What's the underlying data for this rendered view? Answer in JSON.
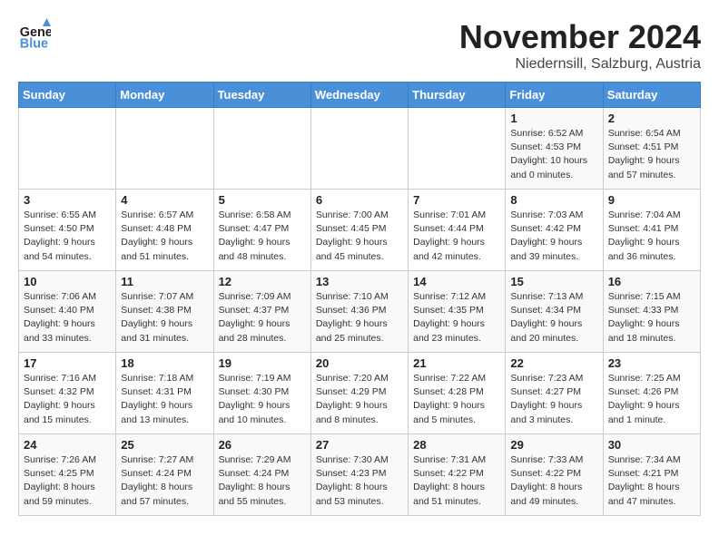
{
  "logo": {
    "line1": "General",
    "line2": "Blue"
  },
  "title": "November 2024",
  "subtitle": "Niedernsill, Salzburg, Austria",
  "header": {
    "days": [
      "Sunday",
      "Monday",
      "Tuesday",
      "Wednesday",
      "Thursday",
      "Friday",
      "Saturday"
    ]
  },
  "weeks": [
    {
      "cells": [
        {
          "day": "",
          "info": ""
        },
        {
          "day": "",
          "info": ""
        },
        {
          "day": "",
          "info": ""
        },
        {
          "day": "",
          "info": ""
        },
        {
          "day": "",
          "info": ""
        },
        {
          "day": "1",
          "info": "Sunrise: 6:52 AM\nSunset: 4:53 PM\nDaylight: 10 hours\nand 0 minutes."
        },
        {
          "day": "2",
          "info": "Sunrise: 6:54 AM\nSunset: 4:51 PM\nDaylight: 9 hours\nand 57 minutes."
        }
      ]
    },
    {
      "cells": [
        {
          "day": "3",
          "info": "Sunrise: 6:55 AM\nSunset: 4:50 PM\nDaylight: 9 hours\nand 54 minutes."
        },
        {
          "day": "4",
          "info": "Sunrise: 6:57 AM\nSunset: 4:48 PM\nDaylight: 9 hours\nand 51 minutes."
        },
        {
          "day": "5",
          "info": "Sunrise: 6:58 AM\nSunset: 4:47 PM\nDaylight: 9 hours\nand 48 minutes."
        },
        {
          "day": "6",
          "info": "Sunrise: 7:00 AM\nSunset: 4:45 PM\nDaylight: 9 hours\nand 45 minutes."
        },
        {
          "day": "7",
          "info": "Sunrise: 7:01 AM\nSunset: 4:44 PM\nDaylight: 9 hours\nand 42 minutes."
        },
        {
          "day": "8",
          "info": "Sunrise: 7:03 AM\nSunset: 4:42 PM\nDaylight: 9 hours\nand 39 minutes."
        },
        {
          "day": "9",
          "info": "Sunrise: 7:04 AM\nSunset: 4:41 PM\nDaylight: 9 hours\nand 36 minutes."
        }
      ]
    },
    {
      "cells": [
        {
          "day": "10",
          "info": "Sunrise: 7:06 AM\nSunset: 4:40 PM\nDaylight: 9 hours\nand 33 minutes."
        },
        {
          "day": "11",
          "info": "Sunrise: 7:07 AM\nSunset: 4:38 PM\nDaylight: 9 hours\nand 31 minutes."
        },
        {
          "day": "12",
          "info": "Sunrise: 7:09 AM\nSunset: 4:37 PM\nDaylight: 9 hours\nand 28 minutes."
        },
        {
          "day": "13",
          "info": "Sunrise: 7:10 AM\nSunset: 4:36 PM\nDaylight: 9 hours\nand 25 minutes."
        },
        {
          "day": "14",
          "info": "Sunrise: 7:12 AM\nSunset: 4:35 PM\nDaylight: 9 hours\nand 23 minutes."
        },
        {
          "day": "15",
          "info": "Sunrise: 7:13 AM\nSunset: 4:34 PM\nDaylight: 9 hours\nand 20 minutes."
        },
        {
          "day": "16",
          "info": "Sunrise: 7:15 AM\nSunset: 4:33 PM\nDaylight: 9 hours\nand 18 minutes."
        }
      ]
    },
    {
      "cells": [
        {
          "day": "17",
          "info": "Sunrise: 7:16 AM\nSunset: 4:32 PM\nDaylight: 9 hours\nand 15 minutes."
        },
        {
          "day": "18",
          "info": "Sunrise: 7:18 AM\nSunset: 4:31 PM\nDaylight: 9 hours\nand 13 minutes."
        },
        {
          "day": "19",
          "info": "Sunrise: 7:19 AM\nSunset: 4:30 PM\nDaylight: 9 hours\nand 10 minutes."
        },
        {
          "day": "20",
          "info": "Sunrise: 7:20 AM\nSunset: 4:29 PM\nDaylight: 9 hours\nand 8 minutes."
        },
        {
          "day": "21",
          "info": "Sunrise: 7:22 AM\nSunset: 4:28 PM\nDaylight: 9 hours\nand 5 minutes."
        },
        {
          "day": "22",
          "info": "Sunrise: 7:23 AM\nSunset: 4:27 PM\nDaylight: 9 hours\nand 3 minutes."
        },
        {
          "day": "23",
          "info": "Sunrise: 7:25 AM\nSunset: 4:26 PM\nDaylight: 9 hours\nand 1 minute."
        }
      ]
    },
    {
      "cells": [
        {
          "day": "24",
          "info": "Sunrise: 7:26 AM\nSunset: 4:25 PM\nDaylight: 8 hours\nand 59 minutes."
        },
        {
          "day": "25",
          "info": "Sunrise: 7:27 AM\nSunset: 4:24 PM\nDaylight: 8 hours\nand 57 minutes."
        },
        {
          "day": "26",
          "info": "Sunrise: 7:29 AM\nSunset: 4:24 PM\nDaylight: 8 hours\nand 55 minutes."
        },
        {
          "day": "27",
          "info": "Sunrise: 7:30 AM\nSunset: 4:23 PM\nDaylight: 8 hours\nand 53 minutes."
        },
        {
          "day": "28",
          "info": "Sunrise: 7:31 AM\nSunset: 4:22 PM\nDaylight: 8 hours\nand 51 minutes."
        },
        {
          "day": "29",
          "info": "Sunrise: 7:33 AM\nSunset: 4:22 PM\nDaylight: 8 hours\nand 49 minutes."
        },
        {
          "day": "30",
          "info": "Sunrise: 7:34 AM\nSunset: 4:21 PM\nDaylight: 8 hours\nand 47 minutes."
        }
      ]
    }
  ]
}
